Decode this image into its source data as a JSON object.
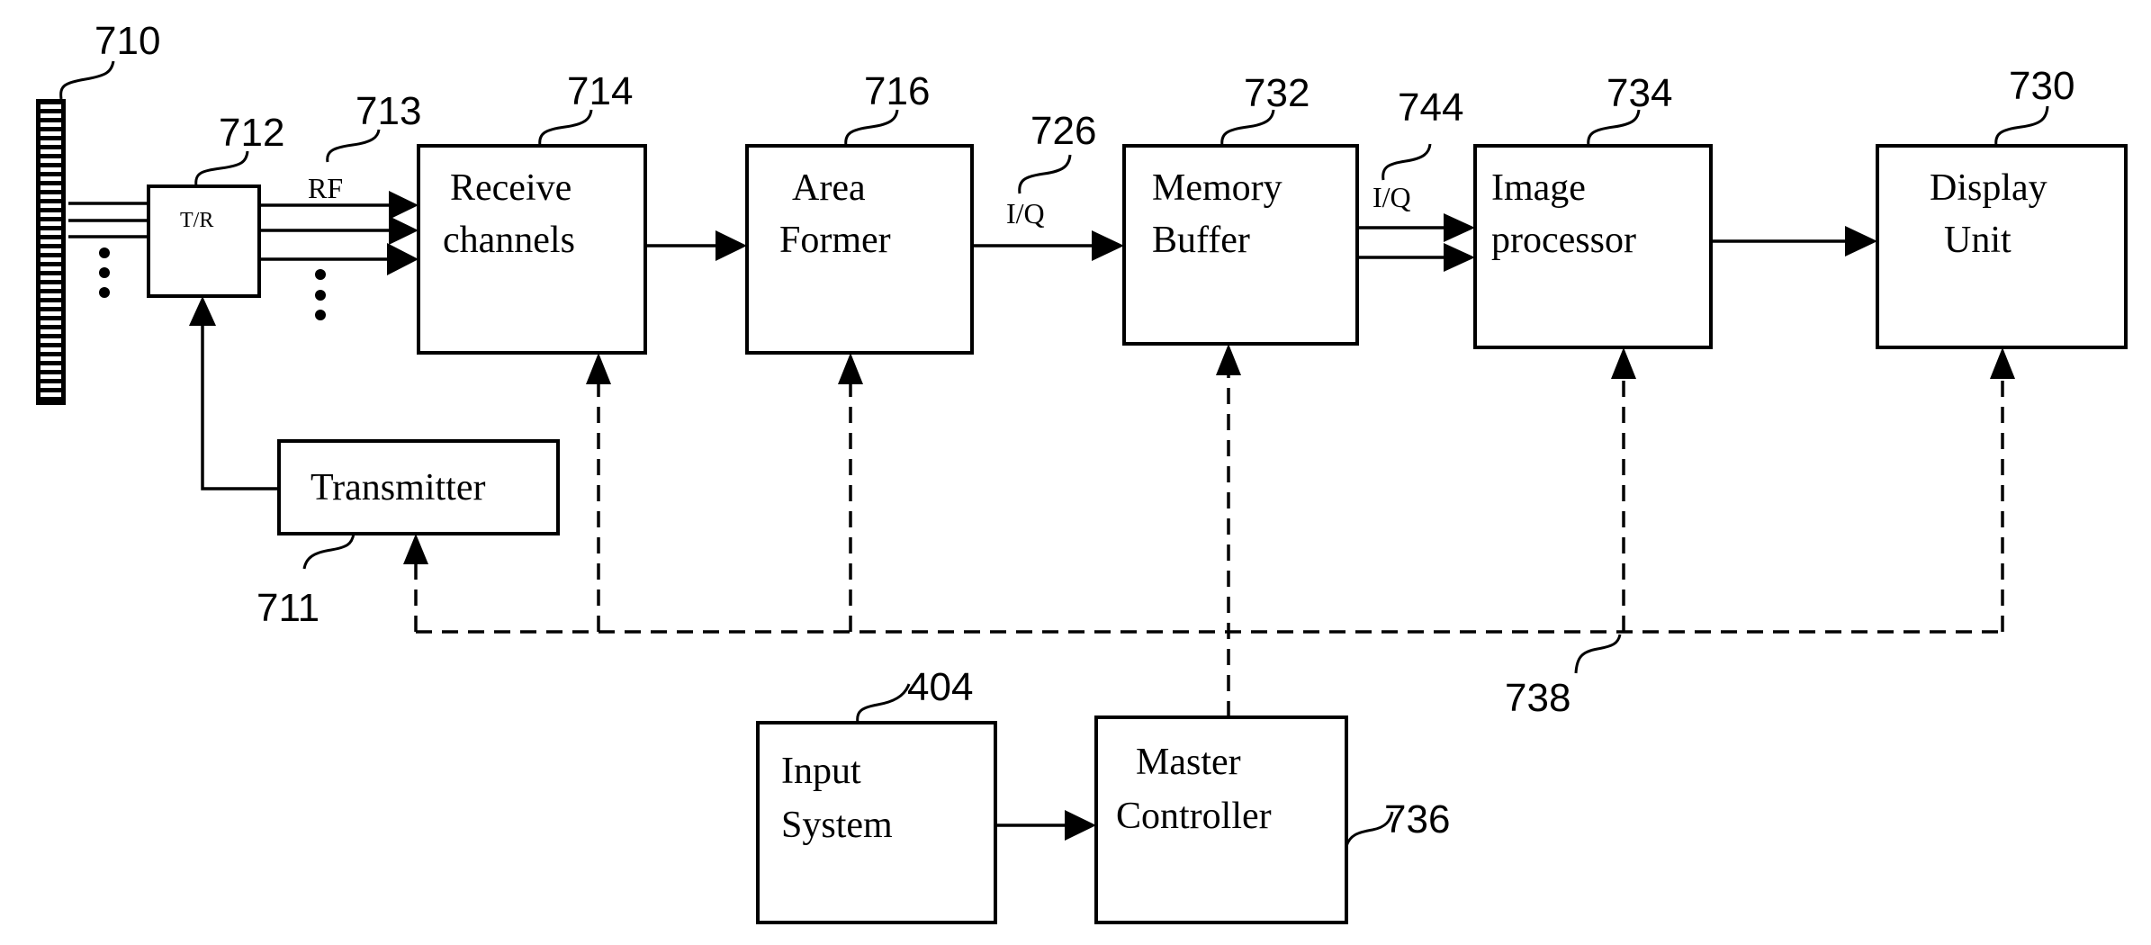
{
  "diagram": {
    "type": "block-diagram",
    "blocks": {
      "antenna": {
        "ref": "710"
      },
      "tr_switch": {
        "ref": "712",
        "label": "T/R"
      },
      "receive": {
        "ref": "714",
        "line1": "Receive",
        "line2": "channels"
      },
      "area_former": {
        "ref": "716",
        "line1": "Area",
        "line2": "Former"
      },
      "memory_buffer": {
        "ref": "732",
        "line1": "Memory",
        "line2": "Buffer"
      },
      "image_processor": {
        "ref": "734",
        "line1": "Image",
        "line2": "processor"
      },
      "display_unit": {
        "ref": "730",
        "line1": "Display",
        "line2": "Unit"
      },
      "transmitter": {
        "ref": "711",
        "label": "Transmitter"
      },
      "input_system": {
        "ref": "404",
        "line1": "Input",
        "line2": "System"
      },
      "master_controller": {
        "ref": "736",
        "line1": "Master",
        "line2": "Controller"
      }
    },
    "signals": {
      "rf": {
        "ref": "713",
        "label": "RF"
      },
      "iq1": {
        "ref": "726",
        "label": "I/Q"
      },
      "iq2": {
        "ref": "744",
        "label": "I/Q"
      },
      "control_bus": {
        "ref": "738"
      }
    },
    "colors": {
      "ink": "#000000",
      "paper": "#ffffff"
    }
  }
}
